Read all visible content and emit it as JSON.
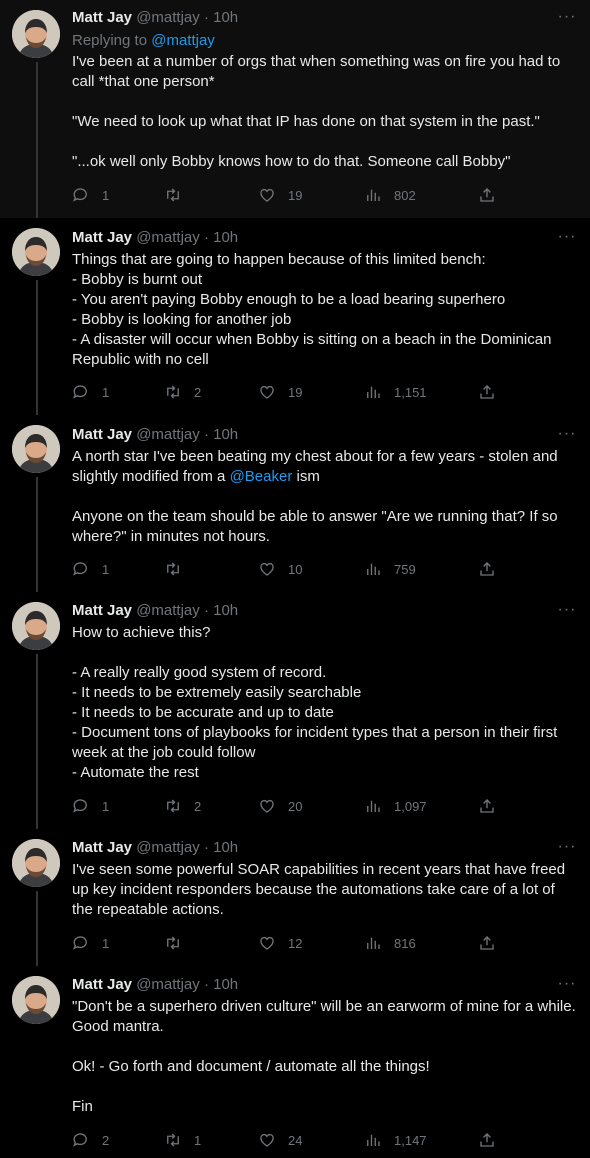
{
  "author": {
    "name": "Matt Jay",
    "handle": "@mattjay",
    "separator": "·",
    "time": "10h"
  },
  "more_label": "···",
  "tweets": [
    {
      "replying_prefix": "Replying to ",
      "replying_to": "@mattjay",
      "text": "I've been at a number of orgs that when something was on fire you had to call *that one person*\n\n\"We need to look up what that IP has done on that system in the past.\"\n\n\"...ok well only Bobby knows how to do that. Someone call Bobby\"",
      "replies": "1",
      "retweets": "",
      "likes": "19",
      "views": "802"
    },
    {
      "text": "Things that are going to happen because of this limited bench:\n- Bobby is burnt out\n- You aren't paying Bobby enough to be a load bearing superhero\n- Bobby is looking for another job\n- A disaster will occur when Bobby is sitting on a beach in the Dominican Republic with no cell",
      "replies": "1",
      "retweets": "2",
      "likes": "19",
      "views": "1,151"
    },
    {
      "text_before": "A north star I've been beating my chest about for a few years - stolen and slightly modified from a ",
      "mention": "@Beaker",
      "text_after": " ism\n\nAnyone on the team should be able to answer \"Are we running that? If so where?\" in minutes not hours.",
      "replies": "1",
      "retweets": "",
      "likes": "10",
      "views": "759"
    },
    {
      "text": "How to achieve this?\n\n- A really really good system of record.\n- It needs to be extremely easily searchable\n- It needs to be accurate and up to date\n- Document tons of playbooks for incident types that a person in their first week at the job could follow\n- Automate the rest",
      "replies": "1",
      "retweets": "2",
      "likes": "20",
      "views": "1,097"
    },
    {
      "text": "I've seen some powerful SOAR capabilities in recent years that have freed up key incident responders because the automations take care of a lot of the repeatable actions.",
      "replies": "1",
      "retweets": "",
      "likes": "12",
      "views": "816"
    },
    {
      "text": "\"Don't be a superhero driven culture\" will be an earworm of mine for a while. Good mantra.\n\nOk! - Go forth and document / automate all the things!\n\nFin",
      "replies": "2",
      "retweets": "1",
      "likes": "24",
      "views": "1,147"
    }
  ],
  "icons": [
    "reply-icon",
    "retweet-icon",
    "like-icon",
    "views-icon",
    "share-icon",
    "more-icon"
  ],
  "colors": {
    "background": "#000000",
    "text": "#e7e9ea",
    "muted": "#71767b",
    "link": "#1d9bf0",
    "rail": "#333639"
  }
}
